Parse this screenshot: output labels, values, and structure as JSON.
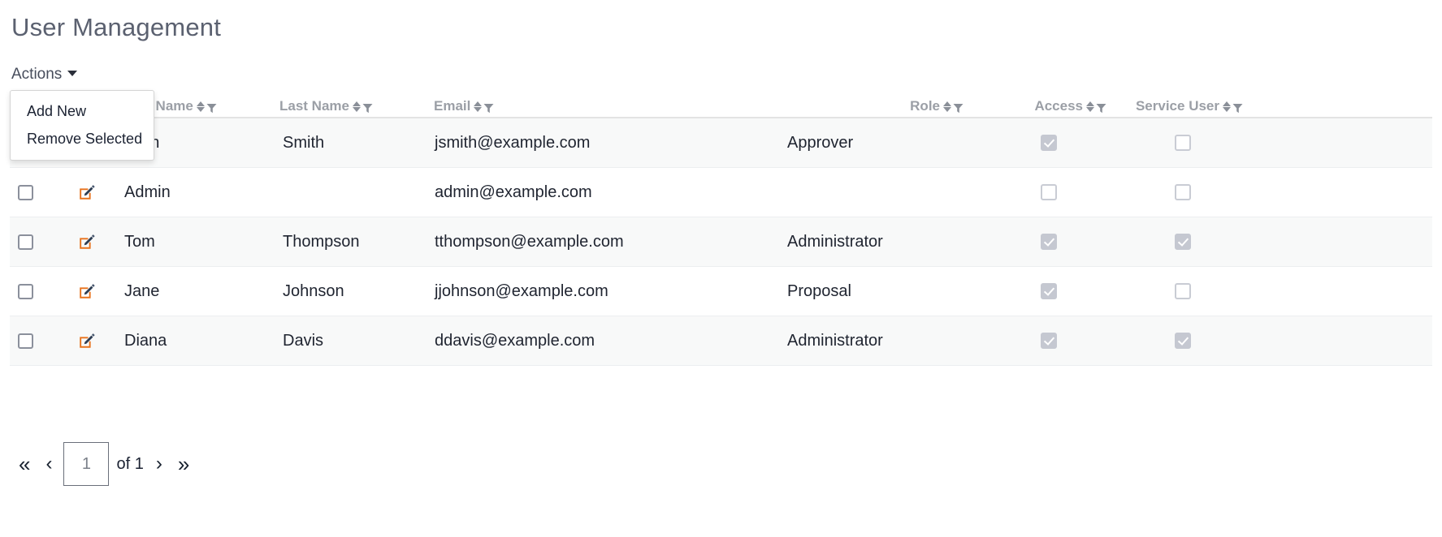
{
  "page": {
    "title": "User Management"
  },
  "toolbar": {
    "actions_label": "Actions",
    "caret_icon": "caret-down-icon",
    "menu": {
      "items": [
        {
          "label": "Add New"
        },
        {
          "label": "Remove Selected"
        }
      ]
    }
  },
  "grid": {
    "columns": [
      {
        "key": "select",
        "label": "",
        "sortable": false,
        "filterable": false
      },
      {
        "key": "edit",
        "label": "",
        "sortable": false,
        "filterable": false
      },
      {
        "key": "first",
        "label": "First Name",
        "sortable": true,
        "filterable": true
      },
      {
        "key": "last",
        "label": "Last Name",
        "sortable": true,
        "filterable": true
      },
      {
        "key": "email",
        "label": "Email",
        "sortable": true,
        "filterable": true
      },
      {
        "key": "role",
        "label": "Role",
        "sortable": true,
        "filterable": true
      },
      {
        "key": "access",
        "label": "Access",
        "sortable": true,
        "filterable": true
      },
      {
        "key": "service",
        "label": "Service User",
        "sortable": true,
        "filterable": true
      }
    ],
    "rows": [
      {
        "selected": false,
        "first_name": "John",
        "last_name": "Smith",
        "email": "jsmith@example.com",
        "role": "Approver",
        "access": true,
        "service_user": false
      },
      {
        "selected": false,
        "first_name": "Admin",
        "last_name": "",
        "email": "admin@example.com",
        "role": "",
        "access": false,
        "service_user": false
      },
      {
        "selected": false,
        "first_name": "Tom",
        "last_name": "Thompson",
        "email": "tthompson@example.com",
        "role": "Administrator",
        "access": true,
        "service_user": true
      },
      {
        "selected": false,
        "first_name": "Jane",
        "last_name": "Johnson",
        "email": "jjohnson@example.com",
        "role": "Proposal",
        "access": true,
        "service_user": false
      },
      {
        "selected": false,
        "first_name": "Diana",
        "last_name": "Davis",
        "email": "ddavis@example.com",
        "role": "Administrator",
        "access": true,
        "service_user": true
      }
    ]
  },
  "pagination": {
    "first_label": "«",
    "prev_label": "‹",
    "next_label": "›",
    "last_label": "»",
    "current_page": "1",
    "of_label": "of 1"
  },
  "colors": {
    "title": "#5b6170",
    "header_text": "#9b9fa6",
    "row_stripe": "#f8f9f9",
    "edit_icon_accent": "#e8721c",
    "edit_icon_body": "#2e3d52",
    "checkbox_disabled": "#c5c8d1"
  }
}
